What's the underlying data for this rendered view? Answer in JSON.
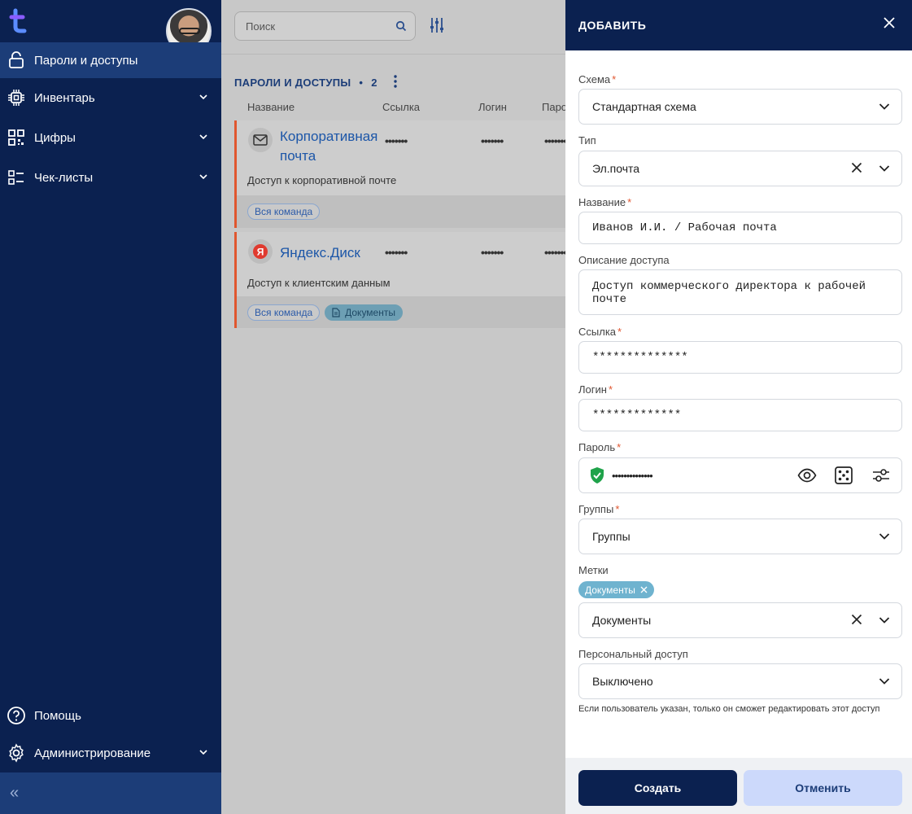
{
  "sidebar": {
    "items": [
      {
        "label": "Пароли и доступы",
        "icon": "lock-icon"
      },
      {
        "label": "Инвентарь",
        "icon": "chip-icon"
      },
      {
        "label": "Цифры",
        "icon": "qr-icon"
      },
      {
        "label": "Чек-листы",
        "icon": "checklist-icon"
      }
    ],
    "bottom_items": [
      {
        "label": "Помощь",
        "icon": "help-icon"
      },
      {
        "label": "Администрирование",
        "icon": "gear-icon"
      }
    ],
    "collapse_glyph": "«"
  },
  "search": {
    "placeholder": "Поиск"
  },
  "list": {
    "title": "ПАРОЛИ И ДОСТУПЫ",
    "count": "2",
    "columns": [
      "Название",
      "Ссылка",
      "Логин",
      "Паро"
    ]
  },
  "cards": [
    {
      "title_line1": "Корпоративная",
      "title_line2": "почта",
      "masked_link": "•••••••",
      "masked_login": "•••••••",
      "masked_password": "•••••••",
      "description": "Доступ к корпоративной почте",
      "chips": [
        "Вся команда"
      ]
    },
    {
      "title": "Яндекс.Диск",
      "masked_link": "•••••••",
      "masked_login": "•••••••",
      "masked_password": "•••••••",
      "description": "Доступ к клиентским данным",
      "chips": [
        "Вся команда"
      ],
      "tag": "Документы"
    }
  ],
  "form": {
    "header": "ДОБАВИТЬ",
    "schema": {
      "label": "Схема",
      "value": "Стандартная схема"
    },
    "type": {
      "label": "Тип",
      "value": "Эл.почта"
    },
    "name": {
      "label": "Название",
      "value": "Иванов И.И. / Рабочая почта"
    },
    "description": {
      "label": "Описание доступа",
      "value_line1": "Доступ коммерческого директора к рабочей",
      "value_line2": "почте"
    },
    "link": {
      "label": "Ссылка",
      "value": "**************"
    },
    "login": {
      "label": "Логин",
      "value": "*************"
    },
    "password": {
      "label": "Пароль",
      "value": "••••••••••••••"
    },
    "groups": {
      "label": "Группы",
      "value": "Группы"
    },
    "tags": {
      "label": "Метки",
      "chip": "Документы",
      "value": "Документы"
    },
    "personal": {
      "label": "Персональный доступ",
      "value": "Выключено",
      "hint": "Если пользователь указан, только он сможет редактировать этот доступ"
    },
    "required_mark": "*"
  },
  "buttons": {
    "create": "Создать",
    "cancel": "Отменить"
  },
  "colors": {
    "sidebar": "#0b2150",
    "active": "#1c3d78",
    "accent": "#e0562f",
    "link": "#1c56a8",
    "tag": "#6fb3cf"
  }
}
